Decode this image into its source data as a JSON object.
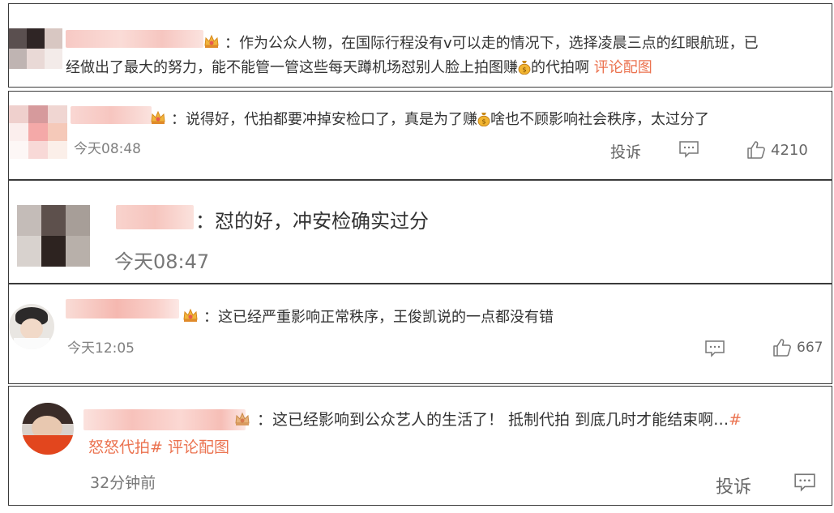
{
  "comments": [
    {
      "line1": "：作为公众人物，在国际行程没有v可以走的情况下，选择凌晨三点的红眼航班，已",
      "line2a": "经做出了最大的努力，能不能管一管这些每天蹲机场怼别人脸上拍图赚",
      "line2b": "的代拍啊 ",
      "link": "评论配图"
    },
    {
      "text_a": "：说得好，代拍都要冲掉安检口了，真是为了赚",
      "text_b": "啥也不顾影响社会秩序，太过分了",
      "time": "今天08:48",
      "report": "投诉",
      "likes": "4210"
    },
    {
      "text": "：怼的好，冲安检确实过分",
      "time": "今天08:47"
    },
    {
      "text": "：这已经严重影响正常秩序，王俊凯说的一点都没有错",
      "time": "今天12:05",
      "likes": "667"
    },
    {
      "line1": "：这已经影响到公众艺人的生活了！ 抵制代拍 到底几时才能结束啊…",
      "hash": "#",
      "line2_tag": "怒怒代拍#",
      "link": " 评论配图",
      "time": "32分钟前",
      "report": "投诉"
    }
  ],
  "colors": {
    "link": "#eb7350",
    "meta": "#808080",
    "border": "#3a3a3a"
  },
  "icons": [
    "crown-icon",
    "money-bag-icon",
    "comment-icon",
    "thumbs-up-icon"
  ]
}
